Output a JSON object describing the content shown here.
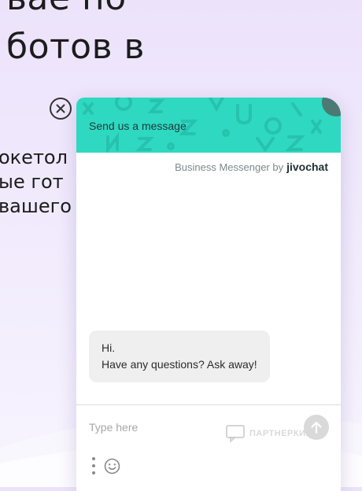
{
  "background": {
    "heading_line1": "ьае по",
    "heading_line2": "ботов в",
    "body_lines": [
      "окетол",
      "ые гот",
      "вашего"
    ]
  },
  "widget": {
    "header_title": "Send us a message",
    "branding_text": "Business Messenger by",
    "brand_name": "jivochat",
    "message_line1": "Hi.",
    "message_line2": "Have any questions? Ask away!",
    "input_placeholder": "Type here",
    "watermark_text": "ПАРТНЕРКИН",
    "accent_color": "#2fd8c1",
    "icons": {
      "close": "close-circle-icon",
      "send": "arrow-up-icon",
      "menu": "more-vertical-icon",
      "emoji": "smiley-icon"
    }
  }
}
